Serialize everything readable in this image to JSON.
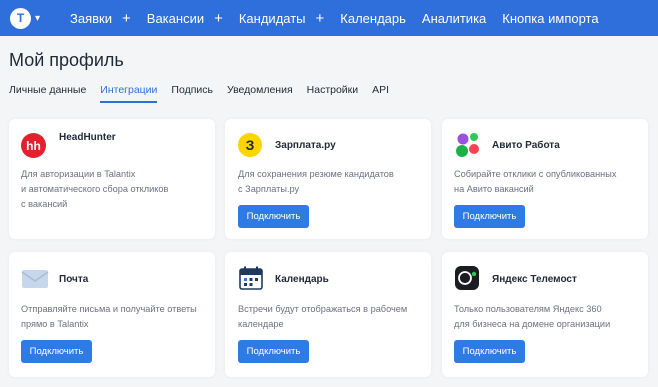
{
  "nav": {
    "logo_letter": "T",
    "items": [
      {
        "label": "Заявки",
        "plus": "+"
      },
      {
        "label": "Вакансии",
        "plus": "+"
      },
      {
        "label": "Кандидаты",
        "plus": "+"
      },
      {
        "label": "Календарь"
      },
      {
        "label": "Аналитика"
      },
      {
        "label": "Кнопка импорта"
      }
    ]
  },
  "page_title": "Мой профиль",
  "tabs": [
    "Личные данные",
    "Интеграции",
    "Подпись",
    "Уведомления",
    "Настройки",
    "API"
  ],
  "active_tab": "Интеграции",
  "cards": [
    {
      "title": "HeadHunter",
      "icon": "headhunter-logo",
      "icon_text": "hh",
      "description": "Для авторизации в Talantix\nи автоматического сбора откликов\nс вакансий",
      "button": ""
    },
    {
      "title": "Зарплата.ру",
      "icon": "zarplata-logo",
      "icon_text": "З",
      "description": "Для сохранения резюме кандидатов\nс Зарплаты.ру",
      "button": "Подключить"
    },
    {
      "title": "Авито Работа",
      "icon": "avito-logo",
      "description": "Собирайте отклики с опубликованных\nна Авито вакансий",
      "button": "Подключить"
    },
    {
      "title": "Почта",
      "icon": "envelope-icon",
      "description": "Отправляйте письма и получайте ответы\nпрямо в Talantix",
      "button": "Подключить"
    },
    {
      "title": "Календарь",
      "icon": "calendar-icon",
      "description": "Встречи будут отображаться в рабочем\nкалендаре",
      "button": "Подключить"
    },
    {
      "title": "Яндекс Телемост",
      "icon": "telemost-icon",
      "description": "Только пользователям Яндекс 360\nдля бизнеса на домене организации",
      "button": "Подключить"
    }
  ],
  "colors": {
    "topbar": "#2f6fdc",
    "button": "#2f7be5",
    "hh_red": "#e5202e",
    "zarplata_yellow": "#ffd400"
  }
}
